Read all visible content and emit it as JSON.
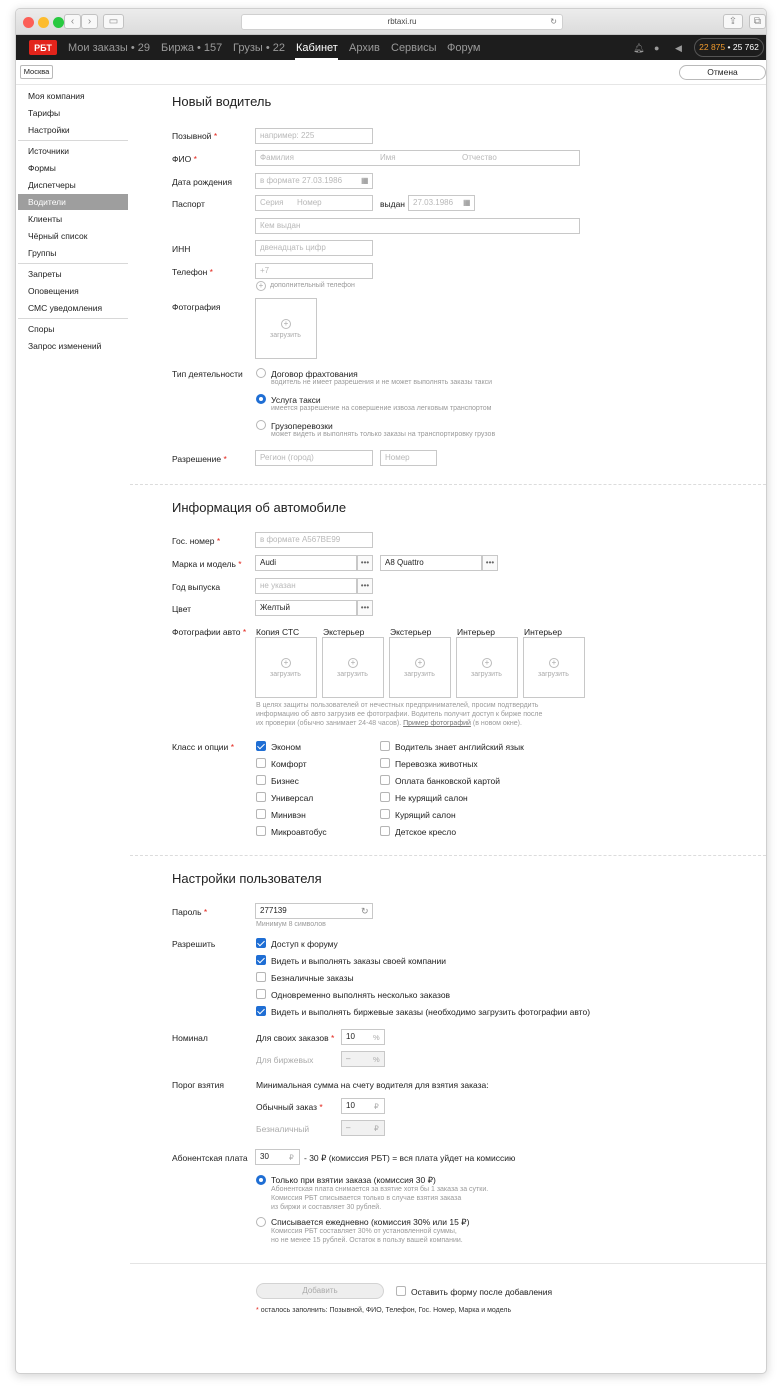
{
  "browser": {
    "url": "rbtaxi.ru"
  },
  "nav": {
    "logo": "РБТ",
    "items": [
      "Мои заказы • 29",
      "Биржа • 157",
      "Грузы • 22",
      "Кабинет",
      "Архив",
      "Сервисы",
      "Форум"
    ],
    "active": "Кабинет",
    "balance_main": "22 875",
    "balance_sep": " • ",
    "balance_second": "25 762"
  },
  "subbar": {
    "city": "Москва",
    "cancel": "Отмена"
  },
  "sidebar": {
    "groups": [
      [
        "Моя компания",
        "Тарифы",
        "Настройки"
      ],
      [
        "Источники",
        "Формы",
        "Диспетчеры",
        "Водители",
        "Клиенты",
        "Чёрный список",
        "Группы"
      ],
      [
        "Запреты",
        "Оповещения",
        "СМС уведомления"
      ],
      [
        "Споры",
        "Запрос изменений"
      ]
    ],
    "selected": "Водители"
  },
  "driver": {
    "title": "Новый водитель",
    "callsign_label": "Позывной",
    "callsign_ph": "например: 225",
    "fio_label": "ФИО",
    "fio_ph": [
      "Фамилия",
      "Имя",
      "Отчество"
    ],
    "dob_label": "Дата рождения",
    "dob_ph": "в формате 27.03.1986",
    "passport_label": "Паспорт",
    "passport_series_ph": "Серия",
    "passport_number_ph": "Номер",
    "issued_label": "выдан",
    "issued_ph": "27.03.1986",
    "issued_by_ph": "Кем выдан",
    "inn_label": "ИНН",
    "inn_ph": "двенадцать цифр",
    "phone_label": "Телефон",
    "phone_ph": "+7",
    "phone_extra": "дополнительный телефон",
    "photo_label": "Фотография",
    "upload": "загрузить",
    "activity_label": "Тип деятельности",
    "activity_options": [
      {
        "title": "Договор фрахтования",
        "desc": "водитель не имеет разрешения и не может выполнять заказы такси",
        "checked": false
      },
      {
        "title": "Услуга такси",
        "desc": "имеется разрешение на совершение извоза легковым транспортом",
        "checked": true
      },
      {
        "title": "Грузоперевозки",
        "desc": "может видеть и выполнять только заказы на транспортировку грузов",
        "checked": false
      }
    ],
    "permit_label": "Разрешение",
    "permit_region_ph": "Регион (город)",
    "permit_number_ph": "Номер"
  },
  "car": {
    "title": "Информация об автомобиле",
    "plate_label": "Гос. номер",
    "plate_ph": "в формате А567ВЕ99",
    "make_label": "Марка и модель",
    "make": "Audi",
    "model": "A8 Quattro",
    "year_label": "Год выпуска",
    "year_ph": "не указан",
    "color_label": "Цвет",
    "color": "Желтый",
    "photos_label": "Фотографии авто",
    "photo_slots": [
      "Копия СТС",
      "Экстерьер",
      "Экстерьер",
      "Интерьер",
      "Интерьер"
    ],
    "note_1": "В целях защиты пользователей от нечестных предпринимателей, просим подтвердить",
    "note_2": "информацию об авто загрузив ее фотографии. Водитель получит доступ к бирже после",
    "note_3_a": "их проверки (обычно занимает 24-48 часов). ",
    "note_3_link": "Пример фотографий",
    "note_3_b": " (в новом окне).",
    "class_label": "Класс и опции",
    "classes": [
      {
        "label": "Эконом",
        "checked": true
      },
      {
        "label": "Комфорт",
        "checked": false
      },
      {
        "label": "Бизнес",
        "checked": false
      },
      {
        "label": "Универсал",
        "checked": false
      },
      {
        "label": "Минивэн",
        "checked": false
      },
      {
        "label": "Микроавтобус",
        "checked": false
      }
    ],
    "options": [
      {
        "label": "Водитель знает английский язык",
        "checked": false
      },
      {
        "label": "Перевозка животных",
        "checked": false
      },
      {
        "label": "Оплата банковской картой",
        "checked": false
      },
      {
        "label": "Не курящий салон",
        "checked": false
      },
      {
        "label": "Курящий салон",
        "checked": false
      },
      {
        "label": "Детское кресло",
        "checked": false
      }
    ]
  },
  "settings": {
    "title": "Настройки пользователя",
    "password_label": "Пароль",
    "password": "277139",
    "password_hint": "Минимум 8 символов",
    "allow_label": "Разрешить",
    "allow": [
      {
        "label": "Доступ к форуму",
        "checked": true
      },
      {
        "label": "Видеть и выполнять заказы своей компании",
        "checked": true
      },
      {
        "label": "Безналичные заказы",
        "checked": false
      },
      {
        "label": "Одновременно выполнять несколько заказов",
        "checked": false
      },
      {
        "label": "Видеть и выполнять биржевые заказы (необходимо загрузить фотографии авто)",
        "checked": true
      }
    ],
    "nominal_label": "Номинал",
    "own_orders_label": "Для своих заказов",
    "own_orders_value": "10",
    "exchange_label": "Для биржевых",
    "exchange_value": "–",
    "percent": "%",
    "threshold_label": "Порог взятия",
    "threshold_desc": "Минимальная сумма на счету водителя для взятия заказа:",
    "regular_label": "Обычный заказ",
    "regular_value": "10",
    "cashless_label": "Безналичный",
    "cashless_value": "–",
    "rub": "₽",
    "fee_label": "Абонентская плата",
    "fee_value": "30",
    "fee_text": "- 30 ₽ (комиссия РБТ) = вся плата уйдет на комиссию",
    "fee_options": [
      {
        "title": "Только при взятии заказа (комиссия 30 ₽)",
        "desc": [
          "Абонентская плата снимается за взятие хотя бы 1 заказа за сутки.",
          "Комиссия РБТ списывается только в случае взятия заказа",
          "из биржи и составляет 30 рублей."
        ],
        "checked": true
      },
      {
        "title": "Списывается ежедневно (комиссия 30% или 15 ₽)",
        "desc": [
          "Комиссия РБТ составляет 30% от установленной суммы,",
          "но не менее 15 рублей. Остаток в пользу вашей компании."
        ],
        "checked": false
      }
    ]
  },
  "footer": {
    "add": "Добавить",
    "keep_form": "Оставить форму после добавления",
    "remaining": "осталось заполнить: Позывной, ФИО, Телефон, Гос. Номер, Марка и модель",
    "asterisk": "*"
  }
}
